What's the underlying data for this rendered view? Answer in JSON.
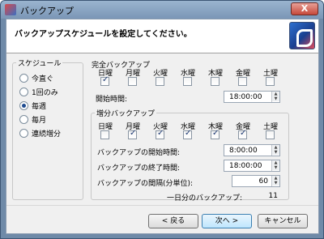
{
  "window": {
    "title": "バックアップ",
    "close_label": "X"
  },
  "header": {
    "text": "バックアップスケジュールを設定してください。"
  },
  "schedule": {
    "title": "スケジュール",
    "options": [
      {
        "label": "今直ぐ",
        "checked": false
      },
      {
        "label": "1回のみ",
        "checked": false
      },
      {
        "label": "毎週",
        "checked": true
      },
      {
        "label": "毎月",
        "checked": false
      },
      {
        "label": "連続増分",
        "checked": false
      }
    ]
  },
  "full_backup": {
    "title": "完全バックアップ",
    "days": [
      "日曜",
      "月曜",
      "火曜",
      "水曜",
      "木曜",
      "金曜",
      "土曜"
    ],
    "checked": [
      true,
      false,
      false,
      false,
      false,
      false,
      false
    ],
    "start_label": "開始時間:",
    "start_value": "18:00:00"
  },
  "incremental": {
    "title": "増分バックアップ",
    "days": [
      "日曜",
      "月曜",
      "火曜",
      "水曜",
      "木曜",
      "金曜",
      "土曜"
    ],
    "checked": [
      false,
      true,
      true,
      true,
      true,
      true,
      false
    ],
    "start_label": "バックアップの開始時間:",
    "start_value": "8:00:00",
    "end_label": "バックアップの終了時間:",
    "end_value": "18:00:00",
    "interval_label": "バックアップの間隔(分単位):",
    "interval_value": "60",
    "per_day_label": "一日分のバックアップ:",
    "per_day_value": "11"
  },
  "buttons": {
    "back": "< 戻る",
    "next": "次へ >",
    "cancel": "キャンセル"
  }
}
